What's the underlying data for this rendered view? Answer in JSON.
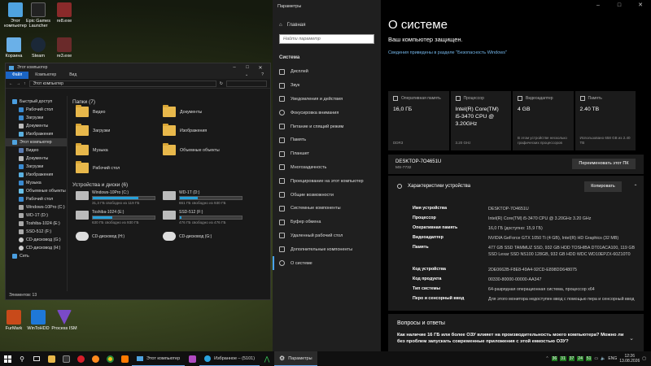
{
  "desktop": {
    "icons": [
      {
        "label": "Этот компьютер",
        "color": "#4fa3e0"
      },
      {
        "label": "Epic Games Launcher",
        "color": "#222222"
      },
      {
        "label": "re8.exe",
        "color": "#8a2a2a"
      },
      {
        "label": "Корзина",
        "color": "#6ab0e8"
      },
      {
        "label": "Steam",
        "color": "#1b2838"
      },
      {
        "label": "re3.exe",
        "color": "#6a2a2a"
      },
      {
        "label": "FurMark",
        "color": "#c84a1a"
      },
      {
        "label": "WinToHDD",
        "color": "#1e78d8"
      },
      {
        "label": "Process ISM",
        "color": "#7a4ac8"
      }
    ]
  },
  "explorer": {
    "title": "Этот компьютер",
    "ribbon_tabs": [
      "Файл",
      "Компьютер",
      "Вид"
    ],
    "address": "Этот компьютер",
    "nav": [
      {
        "label": "Быстрый доступ",
        "sub": false
      },
      {
        "label": "Рабочий стол",
        "sub": true
      },
      {
        "label": "Загрузки",
        "sub": true
      },
      {
        "label": "Документы",
        "sub": true
      },
      {
        "label": "Изображения",
        "sub": true
      },
      {
        "label": "Этот компьютер",
        "sub": false
      },
      {
        "label": "Видео",
        "sub": true
      },
      {
        "label": "Документы",
        "sub": true
      },
      {
        "label": "Загрузки",
        "sub": true
      },
      {
        "label": "Изображения",
        "sub": true
      },
      {
        "label": "Музыка",
        "sub": true
      },
      {
        "label": "Объемные объекты",
        "sub": true
      },
      {
        "label": "Рабочий стол",
        "sub": true
      },
      {
        "label": "Windows-10Pro (C:)",
        "sub": true
      },
      {
        "label": "WD-1T (D:)",
        "sub": true
      },
      {
        "label": "Toshiba-1024 (E:)",
        "sub": true
      },
      {
        "label": "SSD-512 (F:)",
        "sub": true
      },
      {
        "label": "CD-дисковод (G:)",
        "sub": true
      },
      {
        "label": "CD-дисковод (H:)",
        "sub": true
      },
      {
        "label": "Сеть",
        "sub": false
      }
    ],
    "folders_header": "Папки (7)",
    "folders": [
      "Видео",
      "Документы",
      "Загрузки",
      "Изображения",
      "Музыка",
      "Объемные объекты",
      "Рабочий стол"
    ],
    "drives_header": "Устройства и диски (6)",
    "drives": [
      {
        "name": "Windows-10Pro (C:)",
        "free": "31,3 ГБ свободно из 119 ГБ",
        "used_fraction": 0.74
      },
      {
        "name": "WD-1T (D:)",
        "free": "661 ГБ свободно из 930 ГБ",
        "used_fraction": 0.29
      },
      {
        "name": "Toshiba-1024 (E:)",
        "free": "630 ГБ свободно из 930 ГБ",
        "used_fraction": 0.32
      },
      {
        "name": "SSD-512 (F:)",
        "free": "476 ГБ свободно из 476 ГБ",
        "used_fraction": 0.02
      },
      {
        "name": "CD-дисковод (H:)",
        "free": "",
        "used_fraction": null
      },
      {
        "name": "CD-дисковод (G:)",
        "free": "",
        "used_fraction": null
      }
    ],
    "status": "Элементов: 13"
  },
  "settings": {
    "title": "Параметры",
    "home": "Главная",
    "search_placeholder": "Найти параметр",
    "group": "Система",
    "items": [
      "Дисплей",
      "Звук",
      "Уведомления и действия",
      "Фокусировка внимания",
      "Питание и спящий режим",
      "Память",
      "Планшет",
      "Многозадачность",
      "Проецирование на этот компьютер",
      "Общие возможности",
      "Системные компоненты",
      "Буфер обмена",
      "Удаленный рабочий стол",
      "Дополнительные компоненты",
      "О системе"
    ],
    "about": {
      "heading": "О системе",
      "protected": "Ваш компьютер защищен.",
      "protected_link": "Сведения приведены в разделе \"Безопасность Windows\"",
      "cards": [
        {
          "label": "Оперативная память",
          "value": "16,0 ГБ",
          "sub": "DDR3"
        },
        {
          "label": "Процессор",
          "value": "Intel(R) Core(TM) i5-3470 CPU @ 3.20GHz",
          "sub": "3.20 GHz"
        },
        {
          "label": "Видеоадаптер",
          "value": "4 GB",
          "sub": "В этом устройстве несколько графических процессоров"
        },
        {
          "label": "Память",
          "value": "2.40 TB",
          "sub": "Использовано 658 GB из 2.40 TB"
        }
      ],
      "hostname": "DESKTOP-7O4651U",
      "model": "MS-7732",
      "rename_button": "Переименовать этот ПК",
      "specs_title": "Характеристики устройства",
      "copy_button": "Копировать",
      "specs": [
        {
          "key": "Имя устройства",
          "value": "DESKTOP-7O4651U"
        },
        {
          "key": "Процессор",
          "value": "Intel(R) Core(TM) i5-3470 CPU @ 3.20GHz   3.20 GHz"
        },
        {
          "key": "Оперативная память",
          "value": "16,0 ГБ (доступно: 15,9 ГБ)"
        },
        {
          "key": "Видеоадаптер",
          "value": "NVIDIA GeForce GTX 1050 Ti (4 GB), Intel(R) HD Graphics (32 MB)"
        },
        {
          "key": "Память",
          "value": "477 GB SSD TAMMUZ SSD, 932 GB HDD TOSHIBA DT01ACA100, 119 GB SSD Lexar SSD NS100 128GB, 932 GB HDD WDC WD10EPZX-60Z10T0"
        },
        {
          "key": "Код устройства",
          "value": "2DE0662B-F8E8-49A4-92CD-E898DD648075"
        },
        {
          "key": "Код продукта",
          "value": "00330-80000-00000-AA347"
        },
        {
          "key": "Тип системы",
          "value": "64-разрядная операционная система, процессор x64"
        },
        {
          "key": "Перо и сенсорный ввод",
          "value": "Для этого монитора недоступен ввод с помощью пера и сенсорный ввод"
        }
      ],
      "qa_title": "Вопросы и ответы",
      "qa_question": "Как наличие 16 ГБ или более ОЗУ влияет на производительность моего компьютера? Можно ли без проблем запускать современные приложения с этой емкостью ОЗУ?"
    }
  },
  "taskbar": {
    "apps": [
      {
        "label": "Этот компьютер"
      },
      {
        "label": "Избранное – (5101)"
      },
      {
        "label": "Параметры"
      }
    ],
    "tray_temps": [
      "36",
      "31",
      "37",
      "24",
      "51"
    ],
    "lang": "ENG",
    "time": "12:26",
    "date": "13.08.2026"
  }
}
